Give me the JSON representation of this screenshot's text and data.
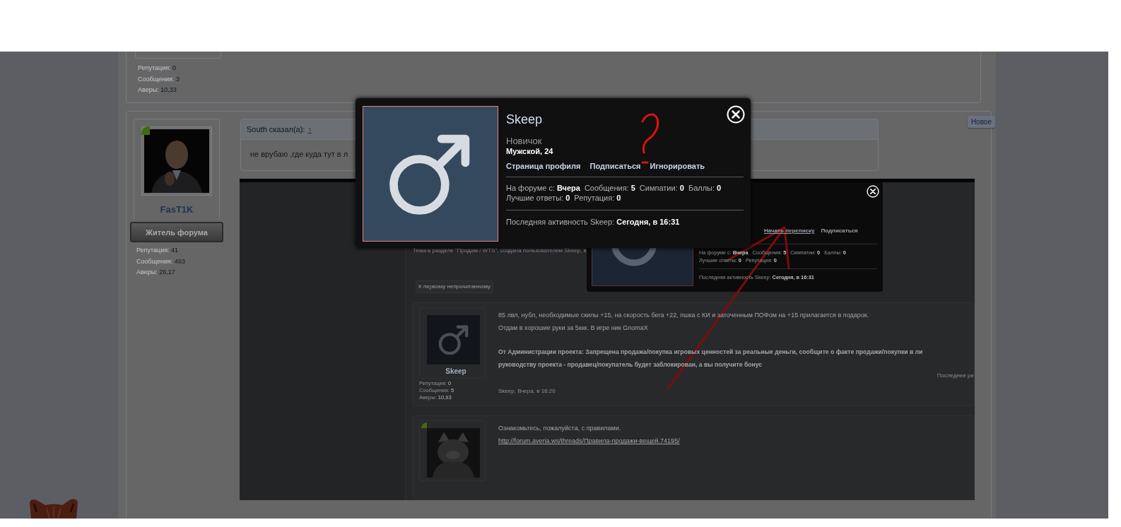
{
  "previous_post": {
    "stats": [
      {
        "label": "Репутация:",
        "value": "0"
      },
      {
        "label": "Сообщения:",
        "value": "3"
      },
      {
        "label": "Аверы:",
        "value": "10,33"
      }
    ]
  },
  "post": {
    "badge": "Новое",
    "author": {
      "name": "FasT1K",
      "online": true,
      "title": "Житель форума",
      "stats": [
        {
          "label": "Репутация:",
          "value": "41"
        },
        {
          "label": "Сообщения:",
          "value": "493"
        },
        {
          "label": "Аверы:",
          "value": "26,17"
        }
      ]
    },
    "quote": {
      "author": "South сказал(а):",
      "jump": "↑"
    },
    "message": "не врубаю ,где куда тут в л",
    "attachment": {
      "thread_info": "Тема в разделе \"Продам / WTS\", создана пользователем Skeep, в",
      "first_unread": "К первому непрочитанному",
      "popup": {
        "actions": [
          {
            "label": "Начать переписку",
            "underlined": true
          },
          {
            "label": "Подписаться",
            "underlined": false
          }
        ],
        "stats": [
          [
            {
              "label": "На форуме с:",
              "value": "Вчера"
            },
            {
              "label": "Сообщения:",
              "value": "5"
            },
            {
              "label": "Симпатии:",
              "value": "0"
            },
            {
              "label": "Баллы:",
              "value": "0"
            }
          ],
          [
            {
              "label": "Лучшие ответы:",
              "value": "0"
            },
            {
              "label": "Репутация:",
              "value": "0"
            }
          ]
        ],
        "last_activity": {
          "label": "Последняя активность Skeep:",
          "value": "Сегодня, в 16:31"
        }
      },
      "posts": [
        {
          "kind": "male",
          "author": "Skeep",
          "stats": [
            {
              "label": "Репутация:",
              "value": "0"
            },
            {
              "label": "Сообщения:",
              "value": "5"
            },
            {
              "label": "Аверы:",
              "value": "10,93"
            }
          ],
          "lines": [
            {
              "kind": "text",
              "text": "85 лвл, нубл, необходимые скилы +15, на скорость бега +22, пшка с КИ и заточенным ПОФом на +15 прилагается в подарок."
            },
            {
              "kind": "text",
              "text": "Отдам в хорошие руки за 5ккк. В игре ник GnomaX"
            },
            {
              "kind": "bold",
              "text": "От Администрации проекта: Запрещена продажа/покупка игровых ценностей за реальные деньги, сообщите о факте продажи/покупки в ли"
            },
            {
              "kind": "bold",
              "text": "руководству проекта - продавец/покупатель будет заблокирован, а вы получите бонус"
            }
          ],
          "footer": "Skeep, Вчера, в 16:20",
          "side_note": "Последнее ре"
        },
        {
          "kind": "picture",
          "online": true,
          "lines": [
            {
              "kind": "text",
              "text": "Ознакомьтесь, пожалуйста, с правилами."
            },
            {
              "kind": "link",
              "text": "http://forum.averia.ws/threads/Правила-продажи-вещей.74195/"
            }
          ]
        }
      ]
    }
  },
  "profile_popup": {
    "name": "Skeep",
    "rank": "Новичок",
    "info": "Мужской, 24",
    "actions": [
      "Страница профиля",
      "Подписаться",
      "Игнорировать"
    ],
    "stats": [
      [
        {
          "label": "На форуме с:",
          "value": "Вчера"
        },
        {
          "label": "Сообщения:",
          "value": "5"
        },
        {
          "label": "Симпатии:",
          "value": "0"
        },
        {
          "label": "Баллы:",
          "value": "0"
        }
      ],
      [
        {
          "label": "Лучшие ответы:",
          "value": "0"
        },
        {
          "label": "Репутация:",
          "value": "0"
        }
      ]
    ],
    "last_activity": {
      "label": "Последняя активность Skeep:",
      "value": "Сегодня, в 16:31"
    }
  }
}
